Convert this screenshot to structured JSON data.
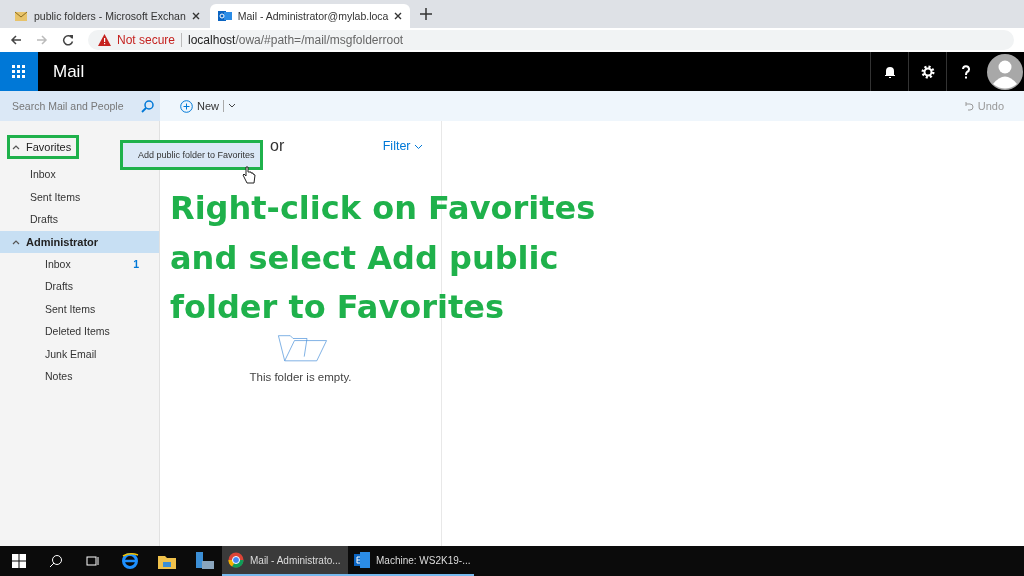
{
  "browser": {
    "tabs": [
      {
        "title": "public folders - Microsoft Exchan",
        "selected": false
      },
      {
        "title": "Mail - Administrator@mylab.loca",
        "selected": true
      }
    ],
    "security": "Not secure",
    "url_host": "localhost",
    "url_path": "/owa/#path=/mail/msgfolderroot"
  },
  "app": {
    "title": "Mail"
  },
  "search": {
    "placeholder": "Search Mail and People"
  },
  "toolbar": {
    "new": "New",
    "undo": "Undo"
  },
  "favorites": {
    "label": "Favorites",
    "expanded": true,
    "items": [
      {
        "label": "Inbox"
      },
      {
        "label": "Sent Items"
      },
      {
        "label": "Drafts"
      }
    ]
  },
  "account": {
    "label": "Administrator",
    "expanded": true,
    "selected": true,
    "items": [
      {
        "label": "Inbox",
        "count": "1"
      },
      {
        "label": "Drafts"
      },
      {
        "label": "Sent Items"
      },
      {
        "label": "Deleted Items"
      },
      {
        "label": "Junk Email"
      },
      {
        "label": "Notes"
      }
    ]
  },
  "message_list": {
    "heading_fragment": "or",
    "filter": "Filter",
    "empty": "This folder is empty."
  },
  "context_menu": {
    "items": [
      "Add public folder to Favorites"
    ]
  },
  "annotation": {
    "lines": [
      "Right-click on Favorites",
      "and select Add public",
      "folder to Favorites"
    ]
  },
  "taskbar": {
    "apps": [
      {
        "label": "Mail - Administrato...",
        "selected": true
      },
      {
        "label": "Machine: WS2K19-...",
        "selected": false
      }
    ]
  }
}
